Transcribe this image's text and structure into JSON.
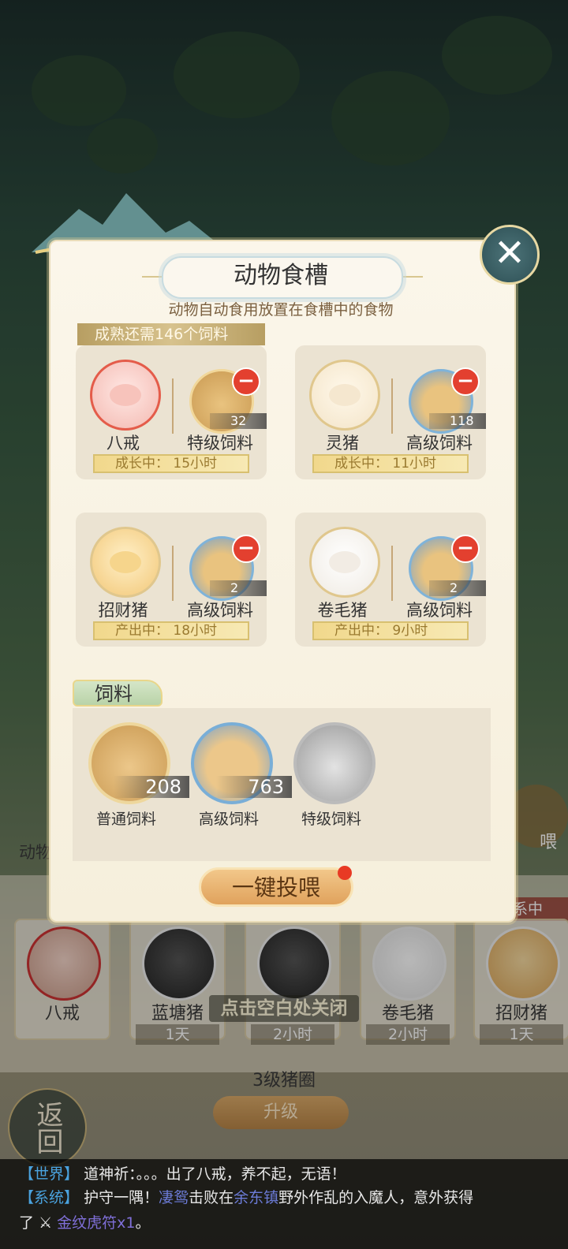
{
  "dialog": {
    "title": "动物食槽",
    "subtitle": "动物自动食用放置在食槽中的食物",
    "mature_note": "成熟还需146个饲料",
    "close_label": "✕",
    "slots": [
      {
        "animal": "八戒",
        "feed": "特级饲料",
        "count": "32",
        "status": "成长中： 15小时"
      },
      {
        "animal": "灵猪",
        "feed": "高级饲料",
        "count": "118",
        "status": "成长中： 11小时"
      },
      {
        "animal": "招财猪",
        "feed": "高级饲料",
        "count": "2",
        "status": "产出中： 18小时"
      },
      {
        "animal": "卷毛猪",
        "feed": "高级饲料",
        "count": "2",
        "status": "产出中： 9小时"
      }
    ],
    "feed_section": {
      "tab": "饲料",
      "items": [
        {
          "label": "普通饲料",
          "count": "208"
        },
        {
          "label": "高级饲料",
          "count": "763"
        },
        {
          "label": "特级饲料",
          "count": ""
        }
      ]
    },
    "feed_all_button": "一键投喂"
  },
  "pen": {
    "animals": [
      {
        "name": "八戒",
        "time": ""
      },
      {
        "name": "蓝塘猪",
        "time": "1天"
      },
      {
        "name": "",
        "time": "2小时"
      },
      {
        "name": "卷毛猪",
        "time": "2小时"
      },
      {
        "name": "招财猪",
        "time": "1天"
      }
    ],
    "close_hint": "点击空白处关闭",
    "level": "3级猪圈",
    "upgrade_button": "升级",
    "back_button": "返回",
    "left_tab": "动物",
    "right_tab": "系中",
    "right_feed_label": "喂"
  },
  "chat": {
    "line1": {
      "channel": "【世界】",
      "text": "道神祈：。。。出了八戒，养不起，无语！"
    },
    "line2": {
      "channel": "【系统】",
      "text_a": "护守一隅！",
      "name": "凄鸳",
      "text_b": "击败在",
      "place": "余东镇",
      "text_c": "野外作乱的入魔人，意外获得"
    },
    "line3": {
      "text_a": "了",
      "item": "金纹虎符x1",
      "text_b": "。"
    }
  }
}
